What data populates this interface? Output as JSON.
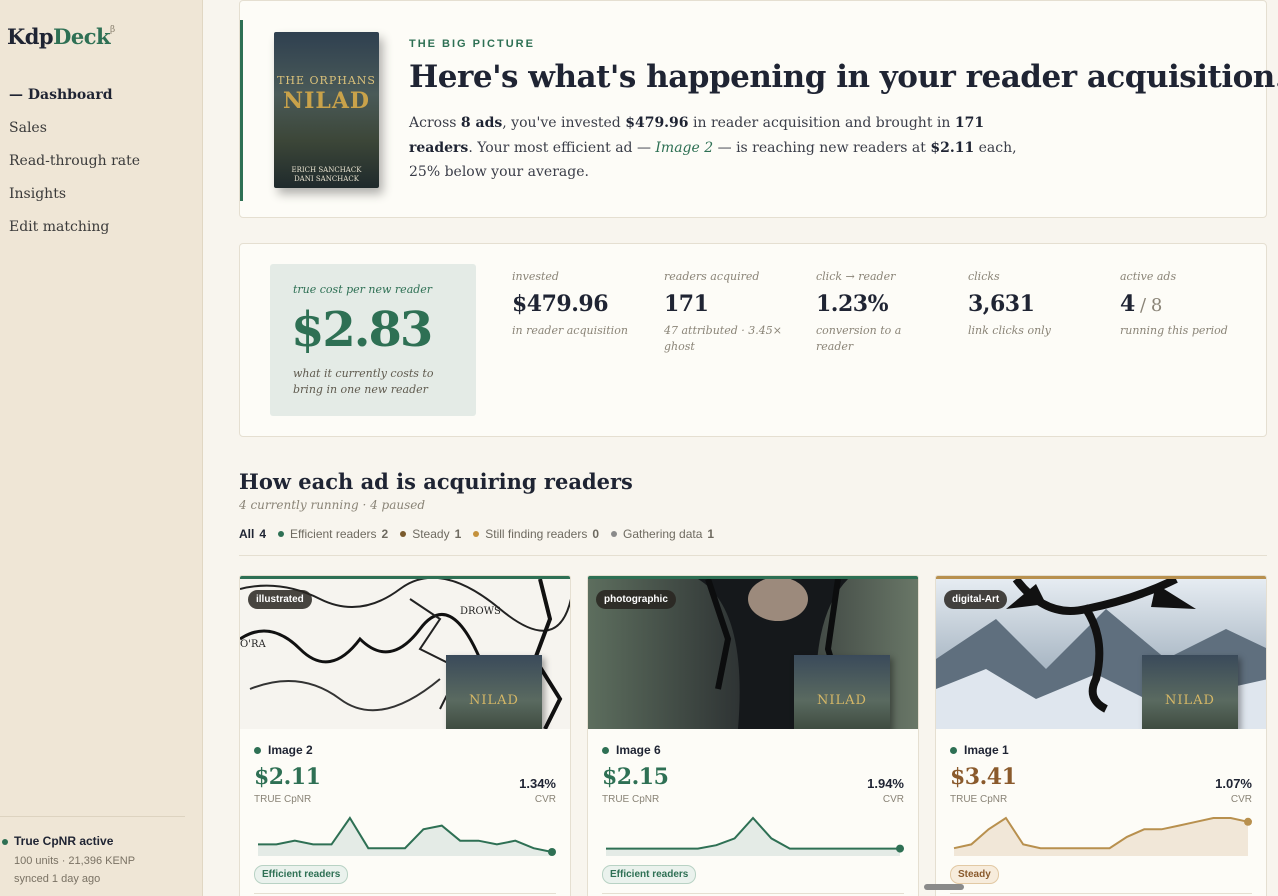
{
  "sidebar": {
    "brand_main": "Kdp",
    "brand_accent": "Deck",
    "brand_sup": "β",
    "nav": [
      {
        "label": "— Dashboard",
        "active": true
      },
      {
        "label": "Sales"
      },
      {
        "label": "Read-through rate"
      },
      {
        "label": "Insights"
      },
      {
        "label": "Edit matching"
      }
    ],
    "status": {
      "label": "True CpNR active",
      "line1": "100 units · 21,396 KENP",
      "line2": "synced 1 day ago"
    }
  },
  "hero": {
    "eyebrow": "THE BIG PICTURE",
    "title": "Here's what's happening in your reader acquisition.",
    "p_a": "Across ",
    "p_ads": "8 ads",
    "p_b": ", you've invested ",
    "p_invested": "$479.96",
    "p_c": " in reader acquisition and brought in ",
    "p_readers": "171 readers",
    "p_d": ". Your most efficient ad — ",
    "p_ad": "Image 2",
    "p_e": " — is reaching new readers at ",
    "p_cost": "$2.11",
    "p_f": " each, 25% below your average.",
    "cover": {
      "line1": "THE ORPHANS",
      "line2": "NILAD",
      "author1": "ERICH SANCHACK",
      "author2": "DANI SANCHACK"
    }
  },
  "stats": {
    "primary": {
      "label": "true cost per new reader",
      "value": "$2.83",
      "desc": "what it currently costs to bring in one new reader"
    },
    "items": [
      {
        "key": "invested",
        "value": "$479.96",
        "desc": "in reader acquisition"
      },
      {
        "key": "readers acquired",
        "value": "171",
        "desc": "47 attributed · 3.45× ghost"
      },
      {
        "key": "click → reader",
        "value": "1.23%",
        "desc": "conversion to a reader"
      },
      {
        "key": "clicks",
        "value": "3,631",
        "desc": "link clicks only"
      },
      {
        "key": "active ads",
        "value": "4",
        "denominator": " / 8",
        "desc": "running this period"
      }
    ]
  },
  "section": {
    "title": "How each ad is acquiring readers",
    "subtitle": "4 currently running · 4 paused"
  },
  "filters": [
    {
      "label": "All",
      "count": "4",
      "active": true
    },
    {
      "label": "Efficient readers",
      "count": "2",
      "color": "#2e7054"
    },
    {
      "label": "Steady",
      "count": "1",
      "color": "#7a5a2c"
    },
    {
      "label": "Still finding readers",
      "count": "0",
      "color": "#c4913c"
    },
    {
      "label": "Gathering data",
      "count": "1",
      "color": "#8a8a8a"
    }
  ],
  "colors": {
    "accent": "#2e7054",
    "steady": "#8a6a3a",
    "bg": "#f8f5ee"
  },
  "cards": [
    {
      "tag": "illustrated",
      "name": "Image 2",
      "cpnr": "$2.11",
      "cpnr_label": "TRUE CpNR",
      "cvr": "1.34%",
      "cvr_label": "CVR",
      "status": "Efficient readers",
      "trend": [
        2,
        2,
        3,
        2,
        2,
        9,
        1,
        1,
        1,
        6,
        7,
        3,
        3,
        2,
        3,
        1,
        0
      ]
    },
    {
      "tag": "photographic",
      "name": "Image 6",
      "cpnr": "$2.15",
      "cpnr_label": "TRUE CpNR",
      "cvr": "1.94%",
      "cvr_label": "CVR",
      "status": "Efficient readers",
      "trend": [
        1,
        1,
        1,
        1,
        1,
        1,
        2,
        4,
        10,
        4,
        1,
        1,
        1,
        1,
        1,
        1,
        1
      ]
    },
    {
      "tag": "digital-Art",
      "name": "Image 1",
      "cpnr": "$3.41",
      "cpnr_label": "TRUE CpNR",
      "cvr": "1.07%",
      "cvr_label": "CVR",
      "status": "Steady",
      "trend": [
        1,
        2,
        6,
        9,
        2,
        1,
        1,
        1,
        1,
        1,
        4,
        6,
        6,
        7,
        8,
        9,
        9,
        8
      ]
    }
  ]
}
